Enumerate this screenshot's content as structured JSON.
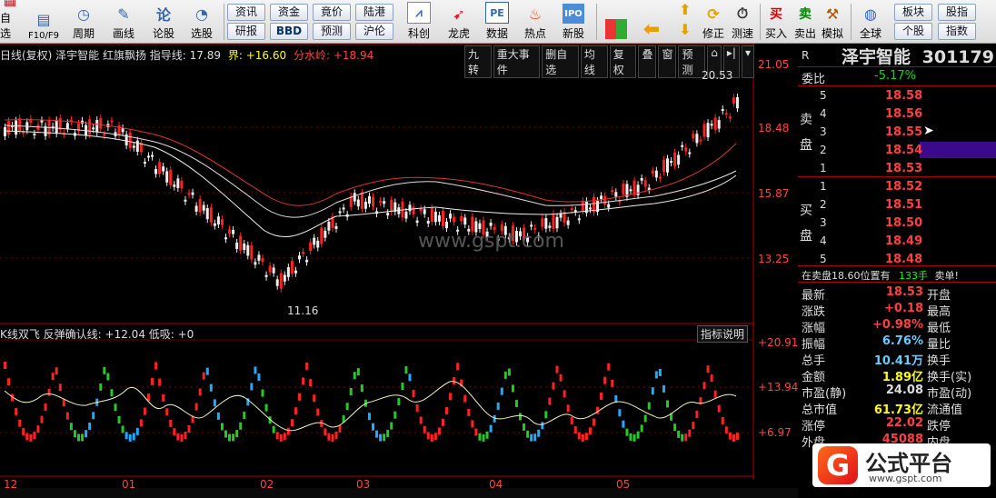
{
  "toolbar": {
    "items": [
      {
        "label": "自选",
        "icon": "grid-icon"
      },
      {
        "label": "F10/F9",
        "icon": "info-icon"
      },
      {
        "label": "周期",
        "icon": "clock-icon"
      },
      {
        "label": "画线",
        "icon": "pencil-icon"
      },
      {
        "label": "论股",
        "icon": "chat-icon"
      },
      {
        "label": "选股",
        "icon": "gauge-icon"
      }
    ],
    "small_buttons": [
      {
        "label": "资讯"
      },
      {
        "label": "资金"
      },
      {
        "label": "竟价"
      },
      {
        "label": "陆港"
      },
      {
        "label": "研报"
      },
      {
        "label": "BBD"
      },
      {
        "label": "预测"
      },
      {
        "label": "沪伦"
      }
    ],
    "icon_items": [
      {
        "label": "科创",
        "icon": "chart-icon"
      },
      {
        "label": "龙虎",
        "icon": "dragon-icon"
      },
      {
        "label": "数据",
        "icon": "pe-icon"
      },
      {
        "label": "热点",
        "icon": "fire-icon"
      },
      {
        "label": "新股",
        "icon": "ipo-icon"
      }
    ],
    "right_items": [
      {
        "label": "修正",
        "icon": "refresh-icon"
      },
      {
        "label": "测速",
        "icon": "stopwatch-icon"
      },
      {
        "label": "买入",
        "icon": "buy-icon"
      },
      {
        "label": "卖出",
        "icon": "sell-icon"
      },
      {
        "label": "模拟",
        "icon": "gavel-icon"
      },
      {
        "label": "全球",
        "icon": "globe-icon"
      }
    ],
    "far_right": [
      {
        "label": "板块"
      },
      {
        "label": "股指"
      },
      {
        "label": "个股"
      },
      {
        "label": "指数"
      }
    ]
  },
  "chart": {
    "header": "日线(复权) 泽宇智能 红旗飘扬 指导线: 17.89",
    "jie_label": "界: +16.60",
    "fenshui_label": "分水岭: +18.94",
    "top_buttons": [
      "九转",
      "重大事件",
      "删自选",
      "均线",
      "复权",
      "叠",
      "窗",
      "预测"
    ],
    "price_ticks": [
      "21.05",
      "18.48",
      "15.87",
      "13.25"
    ],
    "high_label": "20.53",
    "low_label": "11.16",
    "watermark": "www.gspt.com",
    "sub_header": "K线双飞 反弹确认线: +12.04 低吸: +0",
    "sub_button": "指标说明",
    "sub_ticks": [
      "+20.91",
      "+13.94",
      "+6.97"
    ],
    "months": [
      "12",
      "01",
      "02",
      "03",
      "04",
      "05"
    ]
  },
  "quote": {
    "name": "泽宇智能",
    "code": "301179",
    "weibi_label": "委比",
    "weibi": "-5.17%",
    "sell_label": "卖盘",
    "buy_label": "买盘",
    "sell": [
      {
        "n": "5",
        "p": "18.58"
      },
      {
        "n": "4",
        "p": "18.56"
      },
      {
        "n": "3",
        "p": "18.55"
      },
      {
        "n": "2",
        "p": "18.54"
      },
      {
        "n": "1",
        "p": "18.53"
      }
    ],
    "buy": [
      {
        "n": "1",
        "p": "18.52"
      },
      {
        "n": "2",
        "p": "18.51"
      },
      {
        "n": "3",
        "p": "18.50"
      },
      {
        "n": "4",
        "p": "18.49"
      },
      {
        "n": "5",
        "p": "18.48"
      }
    ],
    "notice": "在卖盘18.60位置有",
    "notice_vol": "133手",
    "notice_tail": "卖单!",
    "stats": [
      {
        "k": "最新",
        "v": "18.53",
        "k2": "开盘"
      },
      {
        "k": "涨跌",
        "v": "+0.18",
        "k2": "最高"
      },
      {
        "k": "涨幅",
        "v": "+0.98%",
        "k2": "最低"
      },
      {
        "k": "振幅",
        "v": "6.76%",
        "k2": "量比"
      },
      {
        "k": "总手",
        "v": "10.41万",
        "k2": "换手"
      },
      {
        "k": "金额",
        "v": "1.89亿",
        "k2": "换手(实)"
      },
      {
        "k": "市盈(静)",
        "v": "24.08",
        "k2": "市盈(动)"
      },
      {
        "k": "总市值",
        "v": "61.73亿",
        "k2": "流通值"
      },
      {
        "k": "涨停",
        "v": "22.02",
        "k2": "跌停"
      },
      {
        "k": "外盘",
        "v": "45088",
        "k2": "内盘"
      }
    ],
    "r_label": "R"
  },
  "brand": {
    "name": "公式平台",
    "url": "www.gspt.com",
    "logo": "G"
  }
}
